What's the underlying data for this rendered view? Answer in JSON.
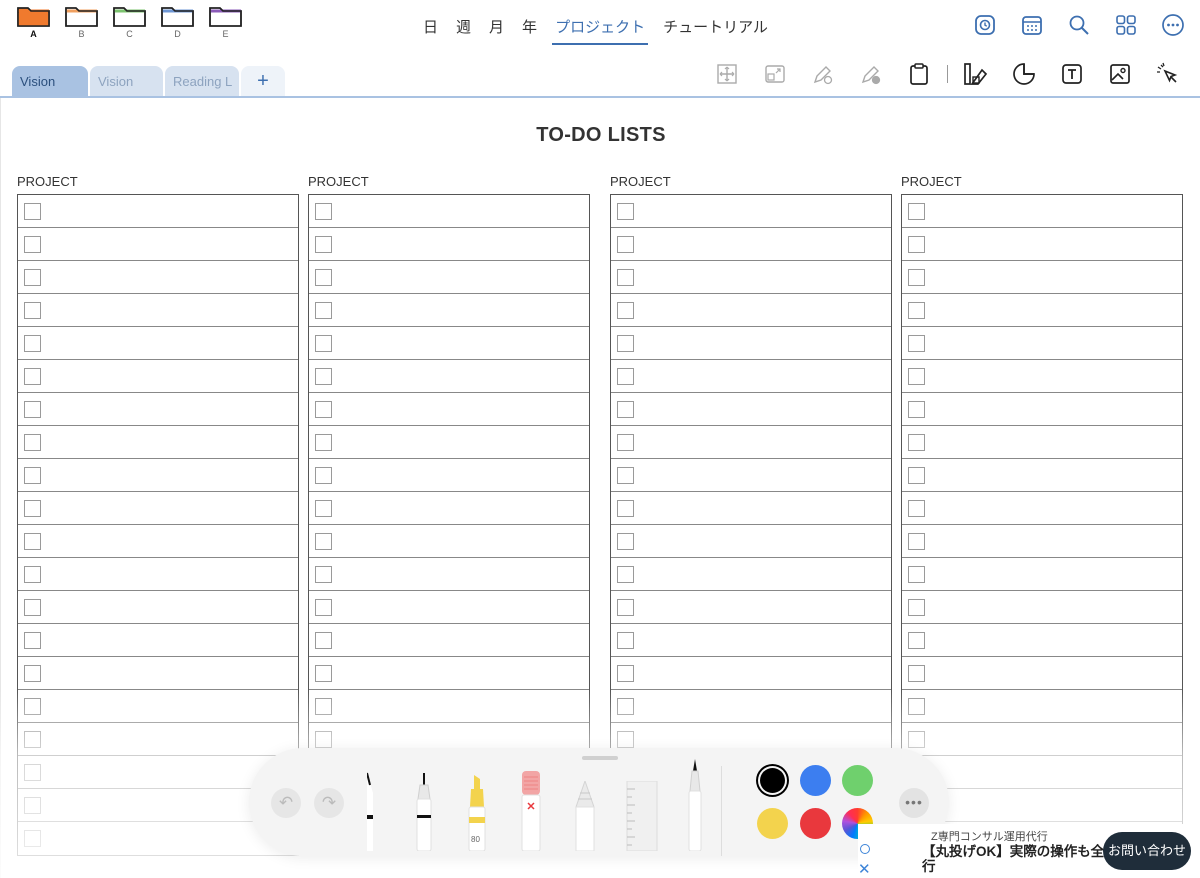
{
  "folders": [
    {
      "letter": "A",
      "color": "#f07a2e",
      "active": true
    },
    {
      "letter": "B",
      "color": "#f0a060",
      "active": false
    },
    {
      "letter": "C",
      "color": "#7cc36f",
      "active": false
    },
    {
      "letter": "D",
      "color": "#6f97d4",
      "active": false
    },
    {
      "letter": "E",
      "color": "#8b5bb8",
      "active": false
    }
  ],
  "nav": {
    "items": [
      "日",
      "週",
      "月",
      "年",
      "プロジェクト",
      "チュートリアル"
    ],
    "active_index": 4
  },
  "top_icons": [
    "sticker-clock-icon",
    "calendar-icon",
    "search-icon",
    "grid-icon",
    "more-icon"
  ],
  "tool_icons": [
    "move-select-icon",
    "resize-icon",
    "pen-settings-icon",
    "pencil-settings-icon",
    "clipboard-icon",
    "shapes-icon",
    "sticker-icon",
    "text-box-icon",
    "image-icon",
    "lasso-pointer-icon"
  ],
  "tabs": [
    {
      "label": "Vision",
      "active": true
    },
    {
      "label": "Vision",
      "active": false
    },
    {
      "label": "Reading L",
      "active": false
    }
  ],
  "tab_add_label": "+",
  "page": {
    "title": "TO-DO LISTS",
    "columns": [
      {
        "label": "PROJECT"
      },
      {
        "label": "PROJECT"
      },
      {
        "label": "PROJECT"
      },
      {
        "label": "PROJECT"
      }
    ],
    "rows_per_column": 20
  },
  "drawbar": {
    "undo_label": "↶",
    "redo_label": "↷",
    "highlighter_size": "80",
    "colors": {
      "black": "#000000",
      "blue": "#3c7ef0",
      "green": "#6fd06d",
      "yellow": "#f3d34d",
      "red": "#e9383d"
    },
    "more_label": "•••"
  },
  "ad": {
    "small_text": "Z専門コンサル運用代行",
    "main_text": "【丸投げOK】実際の操作も全代行",
    "button_label": "お問い合わせ",
    "close_label": "✕"
  }
}
